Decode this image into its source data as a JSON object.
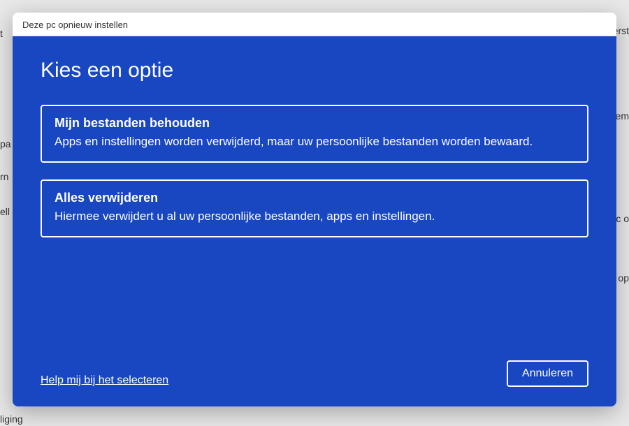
{
  "background": {
    "text_fragments": [
      "t",
      "pa",
      "rn",
      "ell",
      "liging",
      "erst",
      "eem",
      "Pc o",
      "n op"
    ]
  },
  "dialog": {
    "title": "Deze pc opnieuw instellen",
    "heading": "Kies een optie",
    "options": [
      {
        "title": "Mijn bestanden behouden",
        "description": "Apps en instellingen worden verwijderd, maar uw persoonlijke bestanden worden bewaard."
      },
      {
        "title": "Alles verwijderen",
        "description": "Hiermee verwijdert u al uw persoonlijke bestanden, apps en instellingen."
      }
    ],
    "help_link": "Help mij bij het selecteren",
    "cancel_button": "Annuleren"
  }
}
